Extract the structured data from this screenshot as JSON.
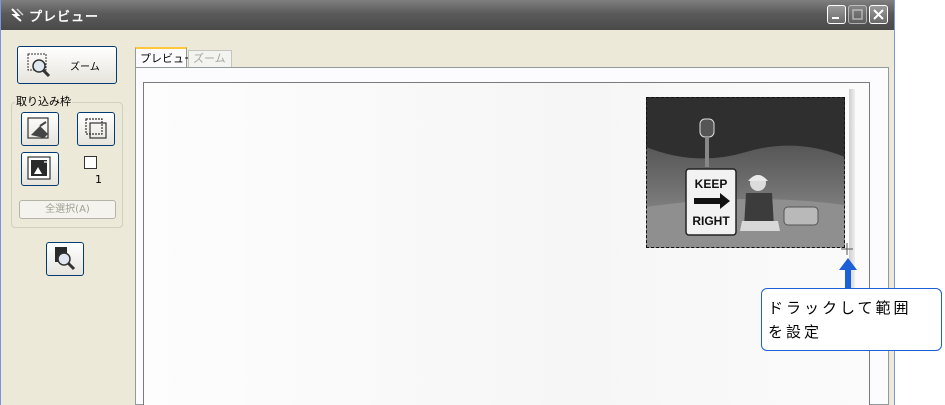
{
  "window": {
    "title": "プレビュー",
    "titlebar_icon": "scanner-app-icon",
    "controls": [
      "minimize-icon",
      "maximize-icon",
      "close-icon"
    ]
  },
  "left_panel": {
    "zoom_button": {
      "label": "ズーム",
      "icon": "magnifier-marquee-icon"
    },
    "frame_group": {
      "label": "取り込み枠",
      "buttons": [
        "auto-locate-icon",
        "copy-frame-icon",
        "preview-frame-icon"
      ],
      "frame_count": "1"
    },
    "select_all": "全選択(A)",
    "preview_button_icon": "preview-magnifier-icon"
  },
  "tabs": [
    {
      "label": "プレビュー",
      "active": true
    },
    {
      "label": "ズーム",
      "active": false
    }
  ],
  "preview": {
    "image_description_icon": "preview-photo",
    "sign_text": [
      "KEEP",
      "RIGHT"
    ]
  },
  "callout": {
    "text_line1": "ドラックして範囲",
    "text_line2": "を設定",
    "color": "#1c5fd6"
  }
}
